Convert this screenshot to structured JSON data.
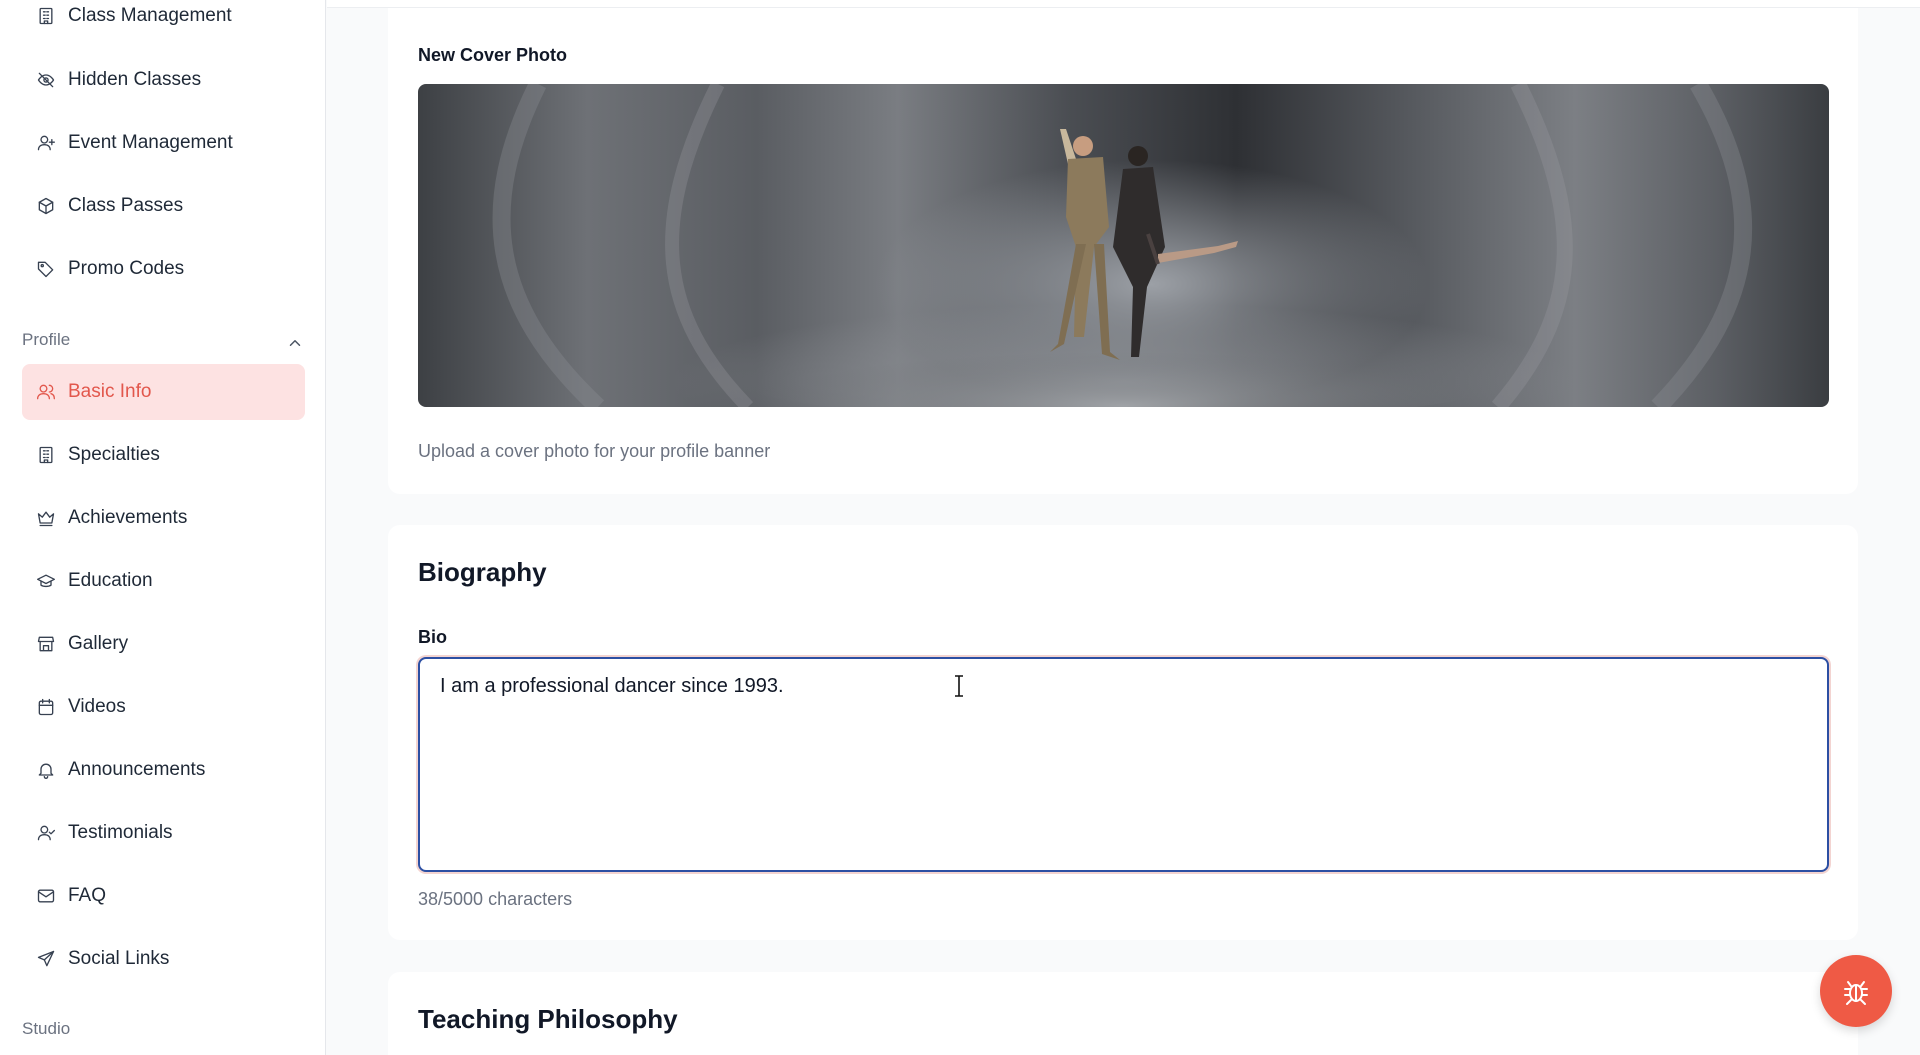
{
  "sidebar": {
    "items_top": [
      {
        "label": "Class Management",
        "icon": "building-icon"
      },
      {
        "label": "Hidden Classes",
        "icon": "eye-off-icon"
      },
      {
        "label": "Event Management",
        "icon": "user-plus-icon"
      },
      {
        "label": "Class Passes",
        "icon": "package-icon"
      },
      {
        "label": "Promo Codes",
        "icon": "tag-icon"
      }
    ],
    "profile_section_label": "Profile",
    "profile_items": [
      {
        "label": "Basic Info",
        "icon": "users-icon",
        "active": true
      },
      {
        "label": "Specialties",
        "icon": "building-icon"
      },
      {
        "label": "Achievements",
        "icon": "crown-icon"
      },
      {
        "label": "Education",
        "icon": "graduation-cap-icon"
      },
      {
        "label": "Gallery",
        "icon": "store-icon"
      },
      {
        "label": "Videos",
        "icon": "calendar-icon"
      },
      {
        "label": "Announcements",
        "icon": "bell-icon"
      },
      {
        "label": "Testimonials",
        "icon": "user-check-icon"
      },
      {
        "label": "FAQ",
        "icon": "mail-icon"
      },
      {
        "label": "Social Links",
        "icon": "send-icon"
      }
    ],
    "studio_section_label": "Studio"
  },
  "cover_card": {
    "label": "New Cover Photo",
    "helper": "Upload a cover photo for your profile banner"
  },
  "biography_card": {
    "heading": "Biography",
    "bio_label": "Bio",
    "bio_value": "I am a professional dancer since 1993.",
    "char_count": "38/5000 characters"
  },
  "philosophy_card": {
    "heading": "Teaching Philosophy"
  },
  "colors": {
    "accent": "#ef5a45",
    "active_bg": "#fde2e2",
    "active_text": "#e2574c",
    "focus_border": "#2c4fa3"
  },
  "fab_icon": "bug-icon"
}
